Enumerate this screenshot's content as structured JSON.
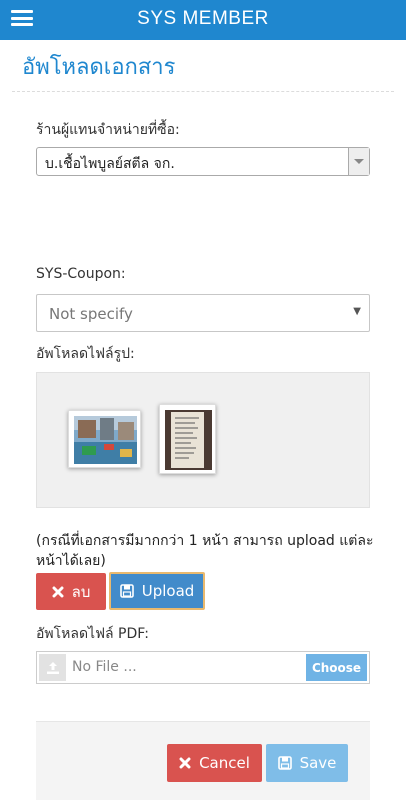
{
  "header": {
    "title": "SYS MEMBER",
    "menu_icon": "hamburger-menu-icon",
    "background": "#1f87cf"
  },
  "page": {
    "title": "อัพโหลดเอกสาร"
  },
  "form": {
    "dealer": {
      "label": "ร้านผู้แทนจำหน่ายที่ซื้อ:",
      "selected": "บ.เชื้อไพบูลย์สตีล จก."
    },
    "coupon": {
      "label": "SYS-Coupon:",
      "selected": "Not specify"
    },
    "image_upload": {
      "label": "อัพโหลดไฟล์รูป:",
      "thumbnails": [
        "photo-thumbnail",
        "document-photo-thumbnail"
      ]
    },
    "note": "(กรณีที่เอกสารมีมากกว่า 1 หน้า สามารถ upload แต่ละหน้าได้เลย)",
    "delete_button": "ลบ",
    "upload_button": "Upload",
    "pdf_upload": {
      "label": "อัพโหลดไฟล์ PDF:",
      "placeholder": "No File ...",
      "choose_button": "Choose"
    }
  },
  "footer": {
    "cancel_button": "Cancel",
    "save_button": "Save"
  },
  "colors": {
    "primary": "#1f87cf",
    "danger": "#d9534f",
    "upload": "#428bca",
    "save": "#7fbde8"
  }
}
